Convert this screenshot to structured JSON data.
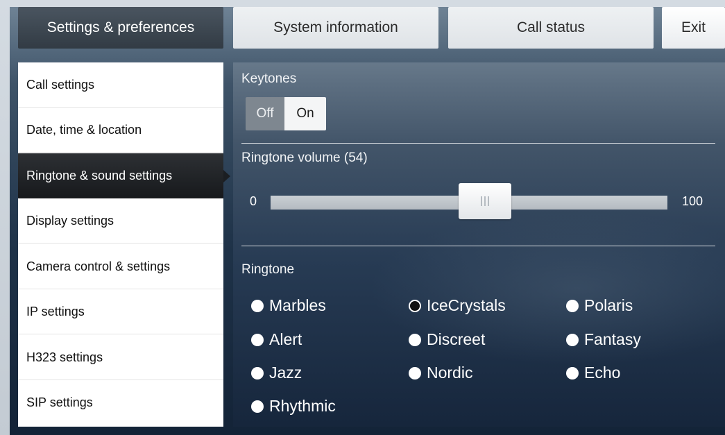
{
  "tabs": [
    {
      "label": "Settings & preferences",
      "active": true
    },
    {
      "label": "System information",
      "active": false
    },
    {
      "label": "Call status",
      "active": false
    }
  ],
  "exit_label": "Exit",
  "menu": [
    {
      "label": "Call settings",
      "active": false
    },
    {
      "label": "Date, time & location",
      "active": false
    },
    {
      "label": "Ringtone & sound settings",
      "active": true
    },
    {
      "label": "Display settings",
      "active": false
    },
    {
      "label": "Camera control & settings",
      "active": false
    },
    {
      "label": "IP settings",
      "active": false
    },
    {
      "label": "H323 settings",
      "active": false
    },
    {
      "label": "SIP settings",
      "active": false
    }
  ],
  "keytones": {
    "title": "Keytones",
    "off_label": "Off",
    "on_label": "On",
    "value": "On"
  },
  "volume": {
    "title": "Ringtone volume (54)",
    "value": 54,
    "min_label": "0",
    "max_label": "100"
  },
  "ringtone": {
    "title": "Ringtone",
    "selected": "IceCrystals",
    "options": [
      "Marbles",
      "IceCrystals",
      "Polaris",
      "Alert",
      "Discreet",
      "Fantasy",
      "Jazz",
      "Nordic",
      "Echo",
      "Rhythmic"
    ]
  },
  "colors": {
    "active_tab": "#323b44",
    "active_menu": "#17191c",
    "content_bg": "#1f3349"
  }
}
